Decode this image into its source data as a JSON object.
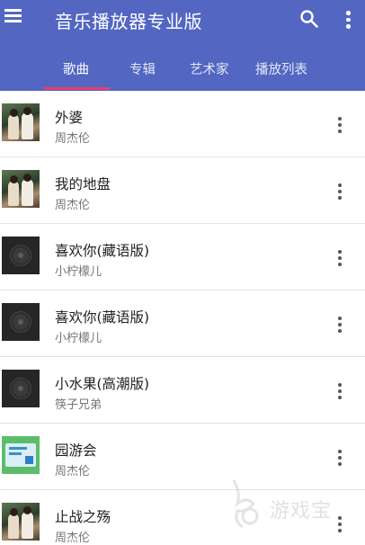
{
  "colors": {
    "appbar": "#5266c2",
    "tab_indicator": "#e43f73",
    "title_text": "#212121",
    "subtitle_text": "#757575"
  },
  "app": {
    "title": "音乐播放器专业版"
  },
  "icons": {
    "menu": "menu-icon",
    "search": "search-icon",
    "overflow": "more-vert-icon"
  },
  "tabs": [
    {
      "label": "歌曲",
      "active": true
    },
    {
      "label": "专辑",
      "active": false
    },
    {
      "label": "艺术家",
      "active": false
    },
    {
      "label": "播放列表",
      "active": false
    }
  ],
  "songs": [
    {
      "title": "外婆",
      "artist": "周杰伦",
      "cover": "photo"
    },
    {
      "title": "我的地盘",
      "artist": "周杰伦",
      "cover": "photo"
    },
    {
      "title": "喜欢你(藏语版)",
      "artist": "小柠檬儿",
      "cover": "disc"
    },
    {
      "title": "喜欢你(藏语版)",
      "artist": "小柠檬儿",
      "cover": "disc"
    },
    {
      "title": "小水果(高潮版)",
      "artist": "筷子兄弟",
      "cover": "disc"
    },
    {
      "title": "园游会",
      "artist": "周杰伦",
      "cover": "green"
    },
    {
      "title": "止战之殇",
      "artist": "周杰伦",
      "cover": "photo"
    }
  ],
  "watermark": {
    "text": "游戏宝"
  }
}
